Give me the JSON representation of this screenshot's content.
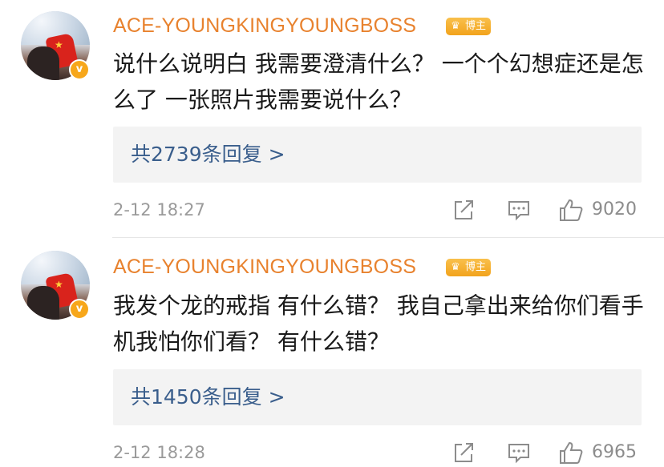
{
  "comments": [
    {
      "username": "ACE-YOUNGKINGYOUNGBOSS",
      "host_badge": "博主",
      "verified_badge": "v",
      "text": "说什么说明白 我需要澄清什么？ 一个个幻想症还是怎么了 一张照片我需要说什么？",
      "replies_label": "共2739条回复 >",
      "time": "2-12 18:27",
      "likes": "9020",
      "icons": [
        "share-icon",
        "comment-icon",
        "thumbs-up-icon"
      ]
    },
    {
      "username": "ACE-YOUNGKINGYOUNGBOSS",
      "host_badge": "博主",
      "verified_badge": "v",
      "text": "我发个龙的戒指 有什么错？ 我自己拿出来给你们看手机我怕你们看？ 有什么错？",
      "replies_label": "共1450条回复 >",
      "time": "2-12 18:28",
      "likes": "6965",
      "icons": [
        "share-icon",
        "comment-icon",
        "thumbs-up-icon"
      ]
    }
  ],
  "colors": {
    "username": "#e8822e",
    "host_badge": "#f2a31d",
    "reply_link": "#3a5e8c",
    "meta": "#9a9a9a",
    "reply_box_bg": "#f3f3f3"
  }
}
